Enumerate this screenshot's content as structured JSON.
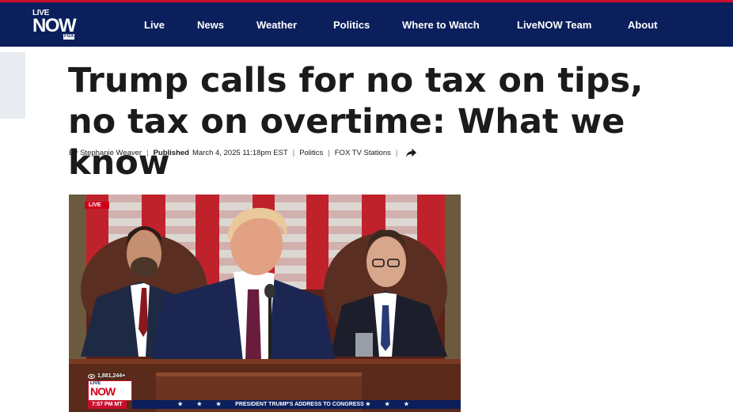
{
  "site": {
    "logo_line1": "LIVE",
    "logo_line2": "NOW",
    "logo_badge": "FOX",
    "brand_color": "#0a1f5c",
    "accent_color": "#c8102e"
  },
  "nav": {
    "items": [
      {
        "label": "Live"
      },
      {
        "label": "News"
      },
      {
        "label": "Weather"
      },
      {
        "label": "Politics"
      },
      {
        "label": "Where to Watch"
      },
      {
        "label": "LiveNOW Team"
      },
      {
        "label": "About"
      }
    ]
  },
  "article": {
    "headline": "Trump calls for no tax on tips, no tax on overtime: What we know",
    "byline": {
      "by_label": "By",
      "author": "Stephanie Weaver",
      "published_label": "Published",
      "published_date": "March 4, 2025 11:18pm EST",
      "category": "Politics",
      "source": "FOX TV Stations",
      "share_icon": "share-arrow-icon"
    }
  },
  "video": {
    "live_tag": "LIVE",
    "view_count": "1,881,244+",
    "bug_line1": "LIVE",
    "bug_line2": "NOW",
    "time": "7:57 PM MT",
    "lower_third": "PRESIDENT TRUMP'S ADDRESS TO CONGRESS"
  }
}
